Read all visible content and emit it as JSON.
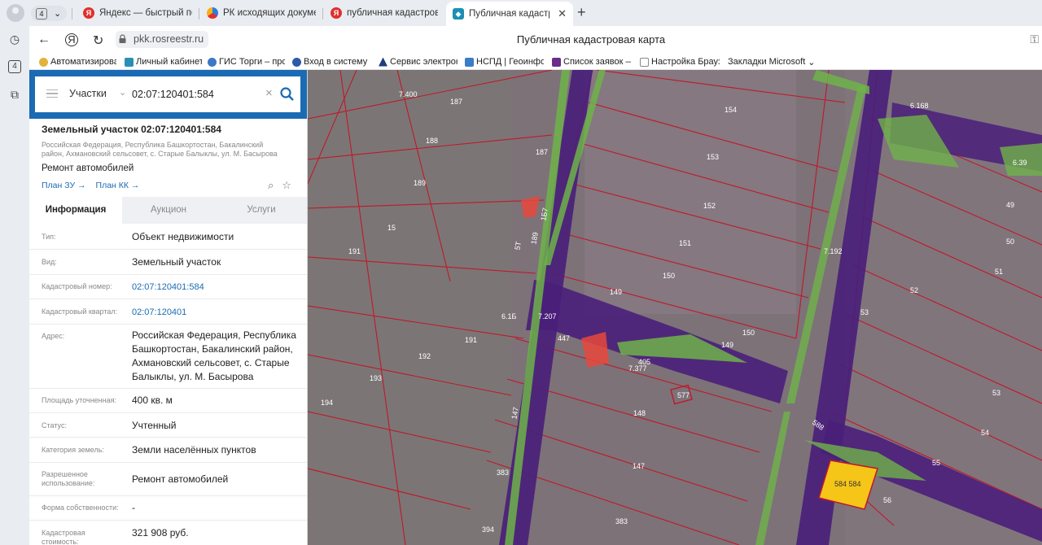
{
  "browser": {
    "tab_count": "4",
    "tabs": [
      {
        "label": "Яндекс — быстрый поиск"
      },
      {
        "label": "РК исходящих документов"
      },
      {
        "label": "публичная кадастровая к"
      },
      {
        "label": "Публичная кадастрова"
      }
    ],
    "side_count": "4",
    "url": "pkk.rosreestr.ru",
    "page_title": "Публичная кадастровая карта",
    "bookmarks": [
      "Автоматизирован",
      "Личный кабинет",
      "ГИС Торги – прод",
      "Вход в систему :: ",
      "Сервис электрон",
      "НСПД | Геоинфор",
      "Список заявок —",
      "Настройка Брауз",
      "Закладки Microsoft"
    ]
  },
  "search": {
    "type_label": "Участки",
    "query": "02:07:120401:584"
  },
  "parcel": {
    "title": "Земельный участок 02:07:120401:584",
    "address_short": "Российская Федерация, Республика Башкортостан, Бакалинский район, Ахмановский сельсовет, с. Старые Балыклы, ул. М. Басырова",
    "use": "Ремонт автомобилей",
    "link_plan_zu": "План ЗУ →",
    "link_plan_kk": "План КК →"
  },
  "tabs": [
    "Информация",
    "Аукцион",
    "Услуги"
  ],
  "info_rows": [
    {
      "key": "Тип:",
      "value": "Объект недвижимости"
    },
    {
      "key": "Вид:",
      "value": "Земельный участок"
    },
    {
      "key": "Кадастровый номер:",
      "value": "02:07:120401:584"
    },
    {
      "key": "Кадастровый квартал:",
      "value": "02:07:120401"
    },
    {
      "key": "Адрес:",
      "value": "Российская Федерация, Республика Башкортостан, Бакалинский район, Ахмановский сельсовет, с. Старые Балыклы, ул. М. Басырова"
    },
    {
      "key": "Площадь уточненная:",
      "value": "400 кв. м"
    },
    {
      "key": "Статус:",
      "value": "Учтенный"
    },
    {
      "key": "Категория земель:",
      "value": "Земли населённых пунктов"
    },
    {
      "key": "Разрешенное использование:",
      "value": "Ремонт автомобилей"
    },
    {
      "key": "Форма собственности:",
      "value": "-"
    },
    {
      "key": "Кадастровая стоимость:",
      "value": "321 908 руб."
    }
  ],
  "map_labels": [
    "7.400",
    "187",
    "188",
    "187",
    "189",
    "15",
    "191",
    "192",
    "191",
    "193",
    "194",
    "147",
    "383",
    "394",
    "154",
    "153",
    "152",
    "151",
    "150",
    "149",
    "150",
    "149",
    "148",
    "147",
    "383",
    "447",
    "405",
    "7.377",
    "577",
    "6.168",
    "6.39",
    "49",
    "50",
    "51",
    "52",
    "53",
    "53",
    "54",
    "55",
    "56",
    "584 584",
    "7.192",
    "7.207",
    "6.1Б",
    "189",
    "5Т",
    "1Б7",
    "588"
  ],
  "colors": {
    "brand": "#1a6bb3",
    "road": "#4a1f7a",
    "green_zone": "#6fb34a",
    "parcel_line": "#c0182a",
    "selected_parcel": "#f5c518",
    "highlight_red": "#e8483c"
  }
}
